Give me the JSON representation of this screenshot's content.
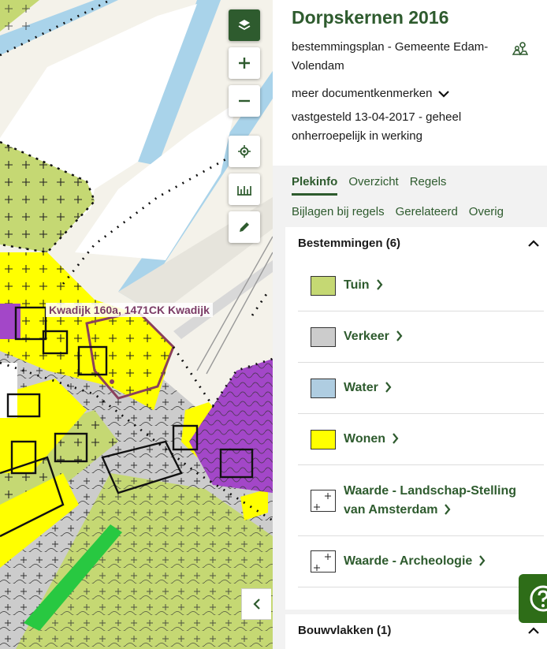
{
  "map": {
    "address_label": "Kwadijk 160a, 1471CK Kwadijk",
    "colors": {
      "tuin": "#c5d873",
      "verkeer": "#cccccc",
      "water": "#afcde1",
      "wonen": "#ffff00",
      "maatschappelijk": "#a347c8",
      "groen": "#28c841",
      "canal": "#a9d3ea"
    },
    "controls": {
      "layers": "layers-icon",
      "zoom_in": "plus-icon",
      "zoom_out": "minus-icon",
      "locate": "locate-icon",
      "measure": "ruler-icon",
      "draw": "pencil-icon",
      "collapse": "chevron-left-icon"
    }
  },
  "panel": {
    "title": "Dorpskernen 2016",
    "subtitle": "bestemmingsplan - Gemeente Edam-Volendam",
    "meta_toggle": "meer documentkenmerken",
    "status": "vastgesteld 13-04-2017 - geheel onherroepelijk in werking",
    "tabs_row1": [
      "Plekinfo",
      "Overzicht",
      "Regels"
    ],
    "tabs_row2": [
      "Bijlagen bij regels",
      "Gerelateerd",
      "Overig"
    ],
    "active_tab": "Plekinfo",
    "bestemmingen": {
      "header": "Bestemmingen (6)",
      "items": [
        {
          "label": "Tuin",
          "color": "#c5d873"
        },
        {
          "label": "Verkeer",
          "color": "#cccccc"
        },
        {
          "label": "Water",
          "color": "#afcde1"
        },
        {
          "label": "Wonen",
          "color": "#ffff00"
        },
        {
          "label": "Waarde - Landschap-Stelling van Amsterdam",
          "color": "#ffffff"
        },
        {
          "label": "Waarde - Archeologie",
          "color": "#ffffff"
        }
      ]
    },
    "bouwvlakken": {
      "header": "Bouwvlakken (1)"
    },
    "accent": "#2e5b2e"
  }
}
